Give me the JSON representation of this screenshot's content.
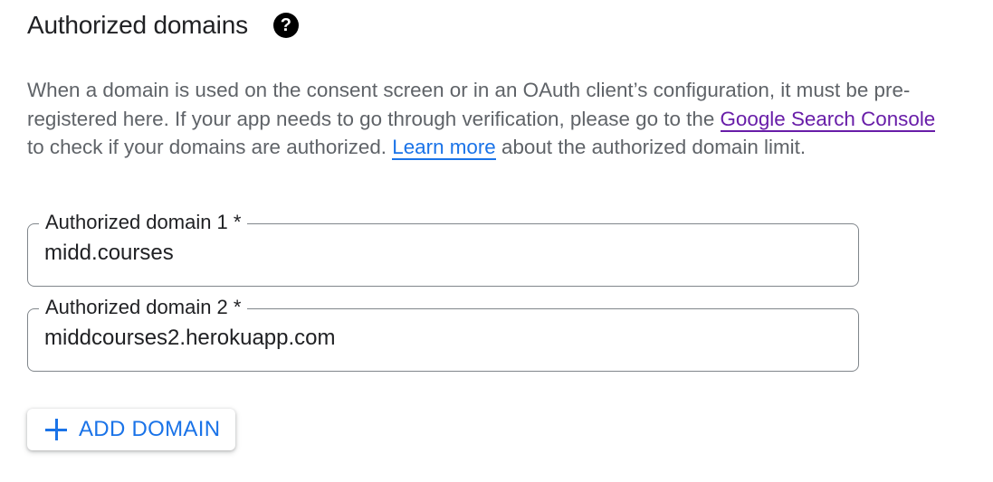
{
  "section": {
    "title": "Authorized domains",
    "help_icon": "?"
  },
  "description": {
    "text_1": "When a domain is used on the consent screen or in an OAuth client’s configuration, it must be pre-registered here. If your app needs to go through verification, please go to the ",
    "link_search_console": "Google Search Console",
    "text_2": " to check if your domains are authorized. ",
    "link_learn_more": "Learn more",
    "text_3": " about the authorized domain limit."
  },
  "fields": [
    {
      "label": "Authorized domain 1 *",
      "value": "midd.courses"
    },
    {
      "label": "Authorized domain 2 *",
      "value": "middcourses2.herokuapp.com"
    }
  ],
  "add_button": {
    "icon": "plus-icon",
    "label": "ADD DOMAIN"
  },
  "colors": {
    "link_visited": "#681da8",
    "link_blue": "#1a73e8",
    "accent": "#1a73e8",
    "text_secondary": "#5f6368"
  }
}
